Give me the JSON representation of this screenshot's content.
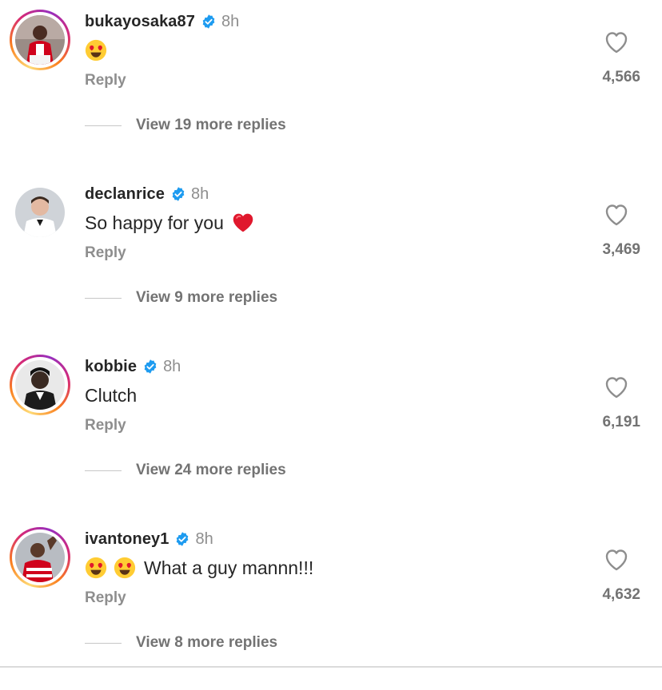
{
  "colors": {
    "verified": "#1d9bf0",
    "muted": "#8e8e8e",
    "text": "#262626",
    "heart_red": "#e0182d"
  },
  "comments": [
    {
      "username": "bukayosaka87",
      "time": "8h",
      "text": "",
      "emojis": [
        "heart-eyes"
      ],
      "reply_label": "Reply",
      "likes": "4,566",
      "view_replies": "View 19 more replies",
      "story_ring": true
    },
    {
      "username": "declanrice",
      "time": "8h",
      "text": "So happy for you",
      "emojis_after": [
        "red-heart"
      ],
      "reply_label": "Reply",
      "likes": "3,469",
      "view_replies": "View 9 more replies",
      "story_ring": false
    },
    {
      "username": "kobbie",
      "time": "8h",
      "text": "Clutch",
      "emojis": [],
      "reply_label": "Reply",
      "likes": "6,191",
      "view_replies": "View 24 more replies",
      "story_ring": true
    },
    {
      "username": "ivantoney1",
      "time": "8h",
      "text": "What a guy mannn!!!",
      "emojis": [
        "heart-eyes",
        "heart-eyes"
      ],
      "reply_label": "Reply",
      "likes": "4,632",
      "view_replies": "View 8 more replies",
      "story_ring": true
    }
  ]
}
